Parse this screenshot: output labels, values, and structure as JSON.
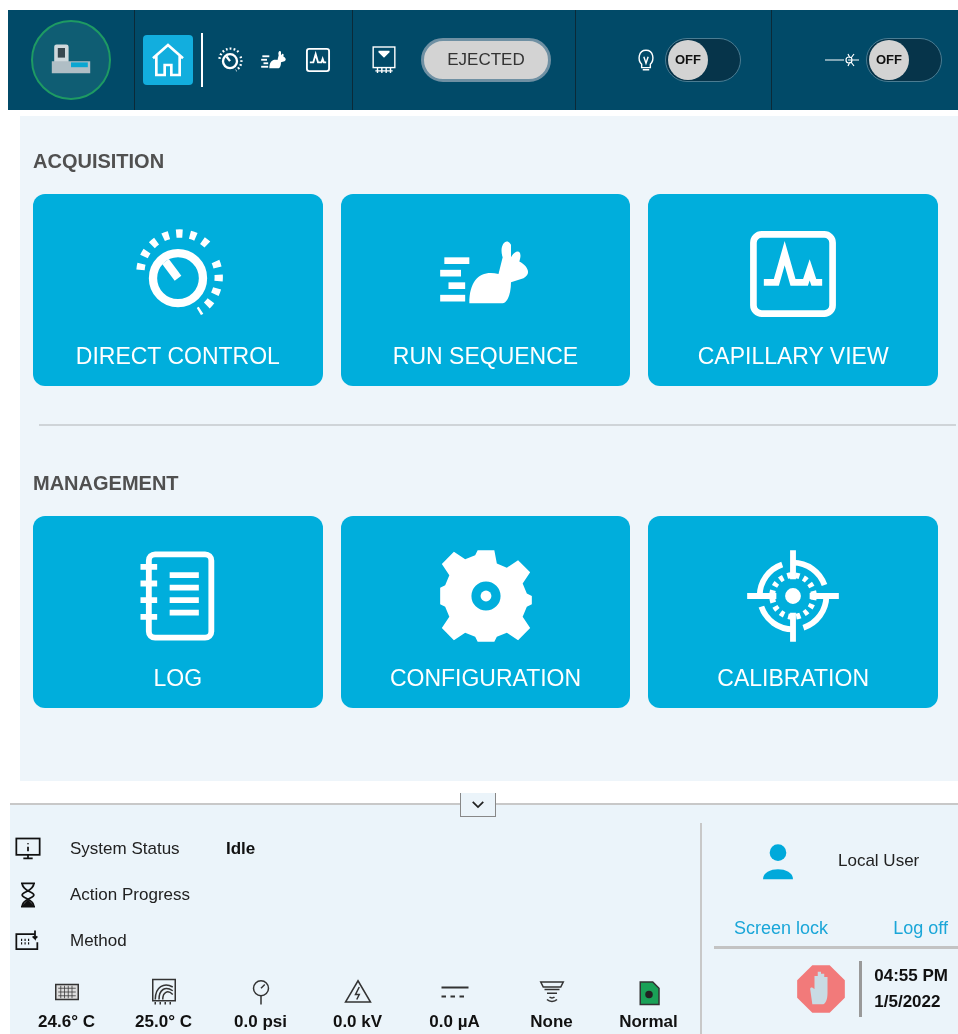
{
  "toolbar": {
    "nav_buttons": [
      {
        "kind": "home",
        "selected": true
      },
      {
        "kind": "dial",
        "selected": false
      },
      {
        "kind": "rabbit",
        "selected": false
      },
      {
        "kind": "peak",
        "selected": false
      }
    ],
    "tray": {
      "status": "EJECTED"
    },
    "toggles": [
      {
        "kind": "lamp",
        "label": "OFF",
        "on": false
      },
      {
        "kind": "laser",
        "label": "OFF",
        "on": false
      }
    ]
  },
  "sections": [
    {
      "title": "ACQUISITION",
      "tiles": [
        {
          "kind": "dial",
          "label": "DIRECT CONTROL"
        },
        {
          "kind": "rabbit",
          "label": "RUN SEQUENCE"
        },
        {
          "kind": "peak",
          "label": "CAPILLARY VIEW"
        }
      ]
    },
    {
      "title": "MANAGEMENT",
      "tiles": [
        {
          "kind": "log",
          "label": "LOG"
        },
        {
          "kind": "gear",
          "label": "CONFIGURATION"
        },
        {
          "kind": "target",
          "label": "CALIBRATION"
        }
      ]
    }
  ],
  "status": [
    {
      "kind": "info",
      "label": "System Status",
      "value": "Idle"
    },
    {
      "kind": "hourglass",
      "label": "Action Progress"
    },
    {
      "kind": "method",
      "label": "Method"
    }
  ],
  "readings": [
    {
      "kind": "plate",
      "value": "24.6° C"
    },
    {
      "kind": "capillary",
      "value": "25.0° C"
    },
    {
      "kind": "gauge",
      "value": "0.0 psi"
    },
    {
      "kind": "voltage",
      "value": "0.0 kV"
    },
    {
      "kind": "current",
      "value": "0.0 µA"
    },
    {
      "kind": "sensor",
      "value": "None"
    },
    {
      "kind": "coolant",
      "value": "Normal"
    }
  ],
  "user": {
    "name": "Local User",
    "links": [
      "Screen lock",
      "Log off"
    ]
  },
  "clock": {
    "time": "04:55 PM",
    "date": "1/5/2022"
  }
}
